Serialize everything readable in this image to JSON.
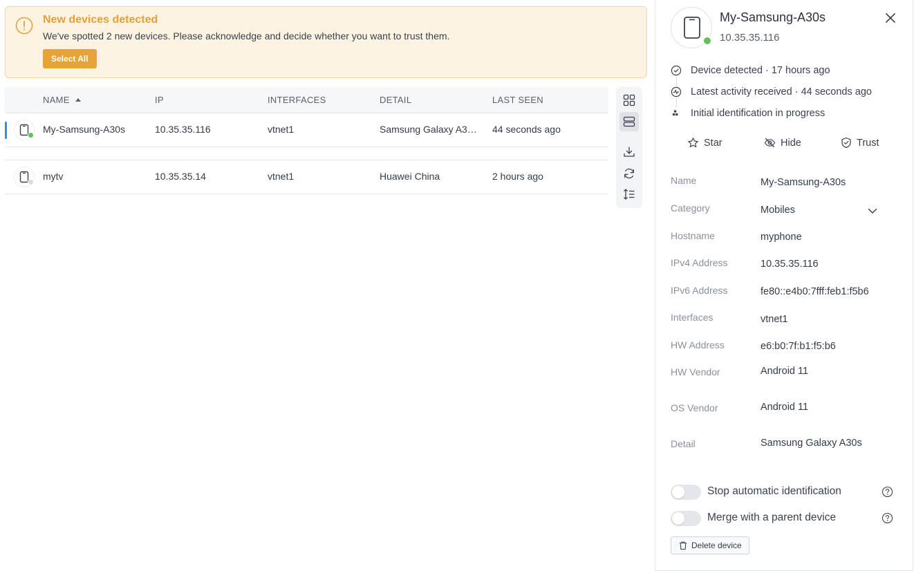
{
  "banner": {
    "title": "New devices detected",
    "text": "We've spotted 2 new devices. Please acknowledge and decide whether you want to trust them.",
    "select_all_label": "Select All",
    "accent_color": "#e8a032"
  },
  "table": {
    "columns": [
      "NAME",
      "IP",
      "INTERFACES",
      "DETAIL",
      "LAST SEEN"
    ],
    "sorted_column": "NAME",
    "sort_direction": "ascending",
    "rows": [
      {
        "name": "My-Samsung-A30s",
        "ip": "10.35.35.116",
        "interfaces": "vtnet1",
        "detail": "Samsung Galaxy A3…",
        "last_seen": "44 seconds ago",
        "status_color": "#5cc35a",
        "selected": true,
        "icon": "phone-icon"
      },
      {
        "name": "mytv",
        "ip": "10.35.35.14",
        "interfaces": "vtnet1",
        "detail": "Huawei China",
        "last_seen": "2 hours ago",
        "status_color": "#d9dbe0",
        "selected": false,
        "icon": "phone-icon"
      }
    ]
  },
  "toolbar": {
    "icons": [
      "grid-view-icon",
      "list-view-icon",
      "download-icon",
      "refresh-icon",
      "row-height-icon"
    ],
    "active": "list-view-icon"
  },
  "panel": {
    "title": "My-Samsung-A30s",
    "ip": "10.35.35.116",
    "status_color": "#5cc35a",
    "timeline": [
      {
        "icon": "check-circle-icon",
        "text": "Device detected · 17 hours ago"
      },
      {
        "icon": "activity-icon",
        "text": "Latest activity received · 44 seconds ago"
      },
      {
        "icon": "progress-icon",
        "text": "Initial identification in progress"
      }
    ],
    "actions": {
      "star": "Star",
      "hide": "Hide",
      "trust": "Trust"
    },
    "properties": {
      "name_label": "Name",
      "name_value": "My-Samsung-A30s",
      "category_label": "Category",
      "category_value": "Mobiles",
      "hostname_label": "Hostname",
      "hostname_value": "myphone",
      "ipv4_label": "IPv4 Address",
      "ipv4_value": "10.35.35.116",
      "ipv6_label": "IPv6 Address",
      "ipv6_value": "fe80::e4b0:7fff:feb1:f5b6",
      "interfaces_label": "Interfaces",
      "interfaces_value": "vtnet1",
      "hw_address_label": "HW Address",
      "hw_address_value": "e6:b0:7f:b1:f5:b6",
      "hw_vendor_label": "HW Vendor",
      "hw_vendor_value": "Android 11",
      "os_vendor_label": "OS Vendor",
      "os_vendor_value": "Android 11",
      "detail_label": "Detail",
      "detail_value": "Samsung Galaxy A30s"
    },
    "toggles": [
      {
        "label": "Stop automatic identification",
        "on": false
      },
      {
        "label": "Merge with a parent device",
        "on": false
      }
    ],
    "delete_label": "Delete device"
  }
}
